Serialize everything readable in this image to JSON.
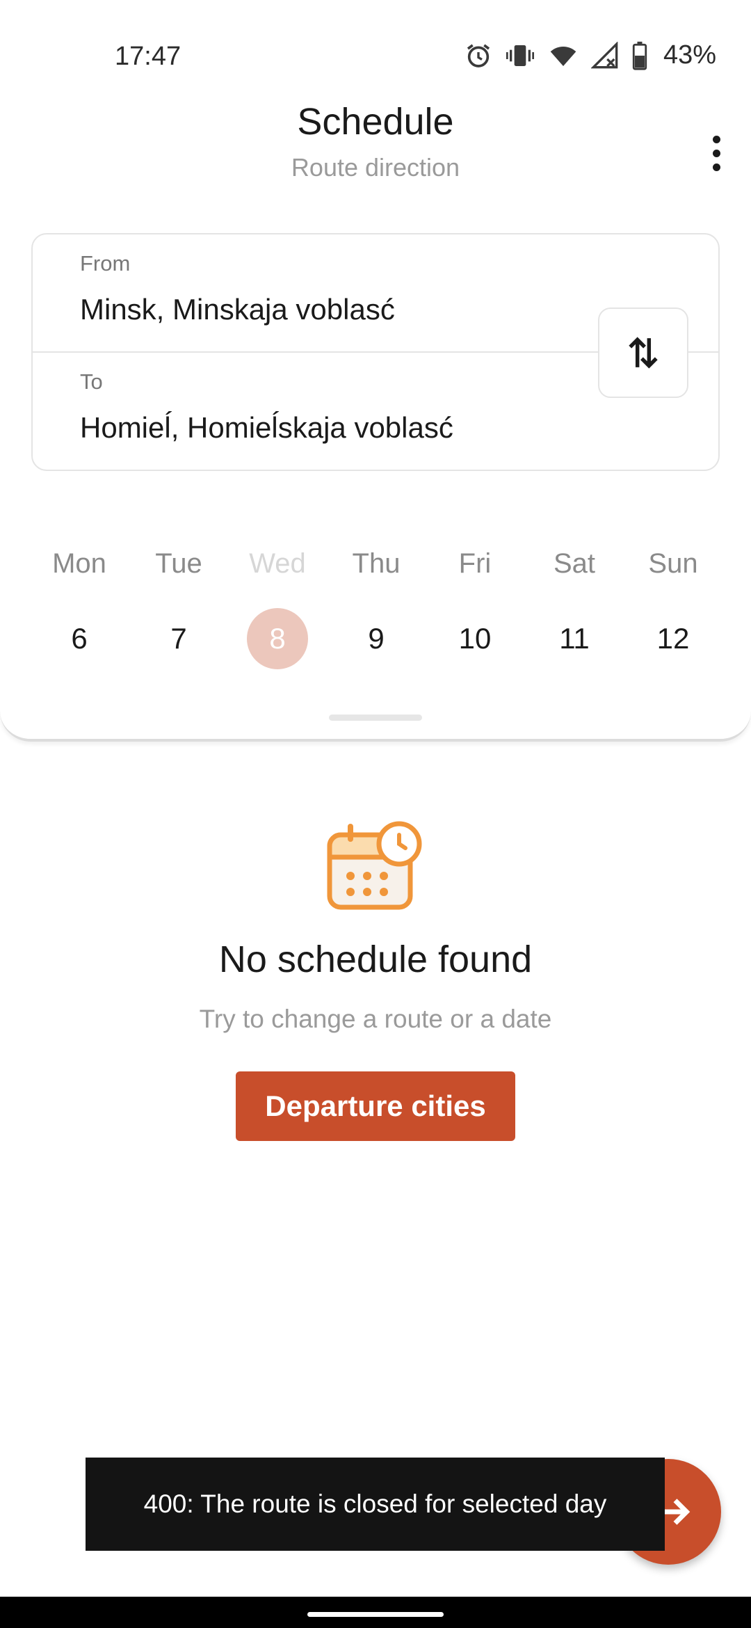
{
  "status_bar": {
    "time": "17:47",
    "battery": "43%",
    "icons": [
      "alarm-icon",
      "vibrate-icon",
      "wifi-icon",
      "signal-icon",
      "battery-icon"
    ]
  },
  "header": {
    "title": "Schedule",
    "subtitle": "Route direction",
    "menu_icon": "more-vert-icon"
  },
  "route": {
    "from_label": "From",
    "from_value": "Minsk, Minskaja voblasć",
    "to_label": "To",
    "to_value": "Homieĺ, Homieĺskaja voblasć",
    "swap_icon": "swap-vertical-icon"
  },
  "week": {
    "days": [
      {
        "name": "Mon",
        "num": "6",
        "disabled": false,
        "selected": false
      },
      {
        "name": "Tue",
        "num": "7",
        "disabled": false,
        "selected": false
      },
      {
        "name": "Wed",
        "num": "8",
        "disabled": true,
        "selected": true
      },
      {
        "name": "Thu",
        "num": "9",
        "disabled": false,
        "selected": false
      },
      {
        "name": "Fri",
        "num": "10",
        "disabled": false,
        "selected": false
      },
      {
        "name": "Sat",
        "num": "11",
        "disabled": false,
        "selected": false
      },
      {
        "name": "Sun",
        "num": "12",
        "disabled": false,
        "selected": false
      }
    ]
  },
  "empty_state": {
    "icon": "calendar-clock-icon",
    "title": "No schedule found",
    "subtitle": "Try to change a route or a date",
    "button_label": "Departure cities"
  },
  "snackbar": {
    "message": "400: The route is closed for selected day"
  },
  "fab": {
    "icon": "arrow-right-icon"
  },
  "colors": {
    "accent": "#c84e2b",
    "icon_orange": "#f0963a",
    "selected_day_bg": "#ecc7bc"
  }
}
